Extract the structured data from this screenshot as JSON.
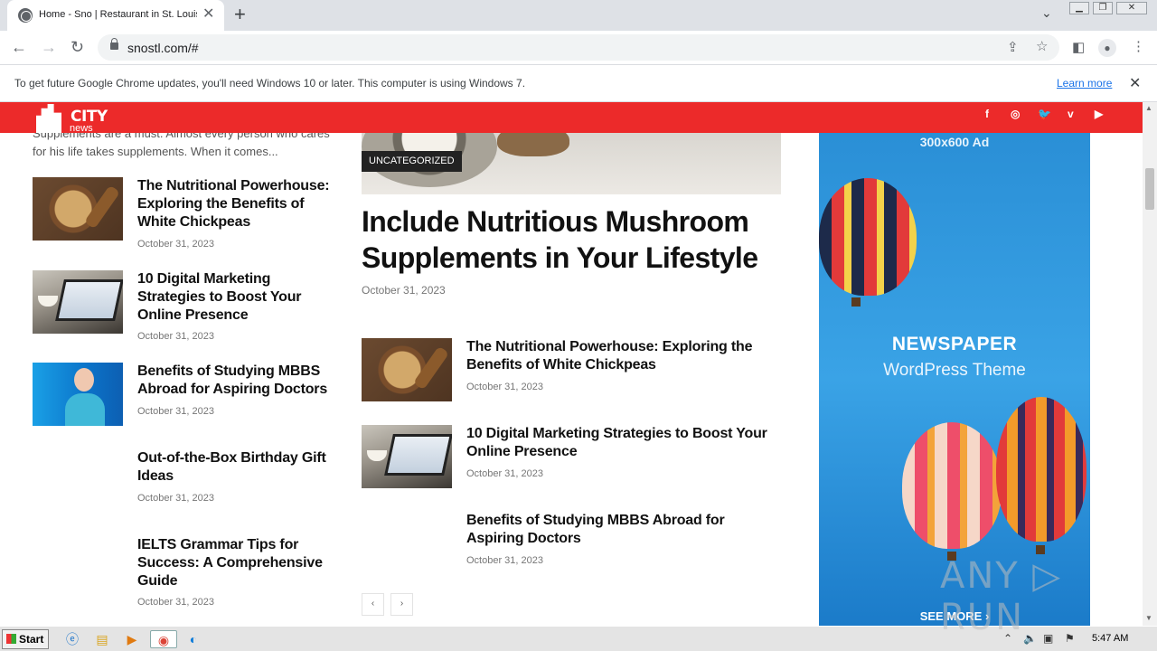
{
  "browser": {
    "tab_title": "Home - Sno | Restaurant in St. Louis",
    "url": "snostl.com/#",
    "infobar_message": "To get future Google Chrome updates, you'll need Windows 10 or later. This computer is using Windows 7.",
    "infobar_link": "Learn more"
  },
  "site": {
    "logo_city": "CITY",
    "logo_news": "news",
    "social": [
      "f",
      "◎",
      "🐦",
      "v",
      "▶"
    ]
  },
  "left_column": {
    "snippet": "Supplements are a must. Almost every person who cares for his life takes supplements. When it comes...",
    "posts": [
      {
        "title": "The Nutritional Powerhouse: Exploring the Benefits of White Chickpeas",
        "date": "October 31, 2023"
      },
      {
        "title": "10 Digital Marketing Strategies to Boost Your Online Presence",
        "date": "October 31, 2023"
      },
      {
        "title": "Benefits of Studying MBBS Abroad for Aspiring Doctors",
        "date": "October 31, 2023"
      },
      {
        "title": "Out-of-the-Box Birthday Gift Ideas",
        "date": "October 31, 2023"
      },
      {
        "title": "IELTS Grammar Tips for Success: A Comprehensive Guide",
        "date": "October 31, 2023"
      }
    ]
  },
  "main_column": {
    "category": "UNCATEGORIZED",
    "hero_title": "Include Nutritious Mushroom Supplements in Your Lifestyle",
    "hero_date": "October 31, 2023",
    "posts": [
      {
        "title": "The Nutritional Powerhouse: Exploring the Benefits of White Chickpeas",
        "date": "October 31, 2023"
      },
      {
        "title": "10 Digital Marketing Strategies to Boost Your Online Presence",
        "date": "October 31, 2023"
      },
      {
        "title": "Benefits of Studying MBBS Abroad for Aspiring Doctors",
        "date": "October 31, 2023"
      }
    ],
    "pager_prev": "‹",
    "pager_next": "›"
  },
  "ad": {
    "label": "300x600 Ad",
    "headline": "NEWSPAPER",
    "subheadline": "WordPress Theme",
    "cta": "SEE MORE ›"
  },
  "watermark": "ANY ▷ RUN",
  "taskbar": {
    "start_label": "Start",
    "clock": "5:47 AM"
  }
}
